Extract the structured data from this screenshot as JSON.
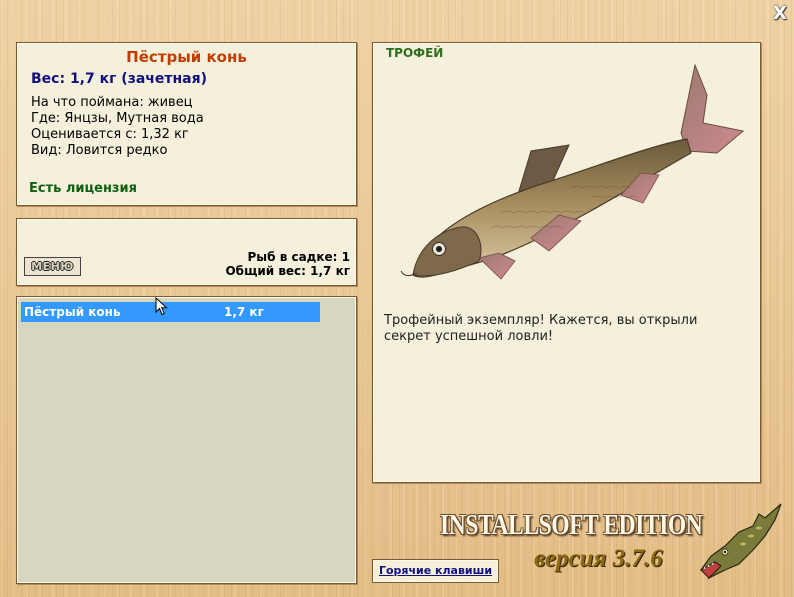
{
  "window": {
    "close_label": "X"
  },
  "fish_info": {
    "name": "Пёстрый конь",
    "weight": "Вес: 1,7 кг (зачетная)",
    "bait": "На что поймана: живец",
    "location": "Где: Янцзы, Мутная вода",
    "value": "Оценивается с: 1,32 кг",
    "rarity": "Вид: Ловится редко",
    "license": "Есть лицензия"
  },
  "cage": {
    "menu_label": "МЕНЮ",
    "fish_count": "Рыб в садке: 1",
    "total_weight": "Общий вес: 1,7 кг"
  },
  "catch_list": {
    "items": [
      {
        "name": "Пёстрый конь",
        "weight": "1,7 кг"
      }
    ]
  },
  "trophy": {
    "label": "ТРОФЕЙ",
    "text": "Трофейный экземпляр! Кажется, вы открыли секрет успешной ловли!"
  },
  "branding": {
    "title": "INSTALLSOFT EDITION",
    "version": "версия 3.7.6"
  },
  "hotkeys": {
    "label": "Горячие клавиши"
  },
  "colors": {
    "selection": "#3399ff",
    "fish_name": "#c03c00",
    "weight_text": "#101080",
    "license_text": "#106010",
    "trophy_label": "#2e6e1e"
  }
}
